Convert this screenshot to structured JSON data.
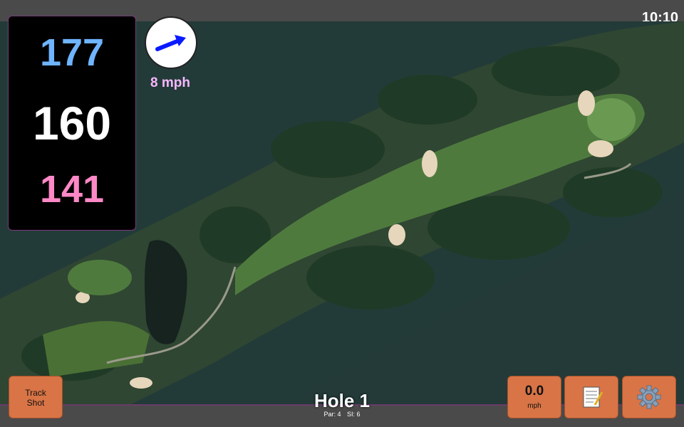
{
  "clock": "10:10",
  "distances": {
    "back": "177",
    "middle": "160",
    "front": "141"
  },
  "wind": {
    "speed": "8 mph",
    "icon": "wind-arrow-icon"
  },
  "buttons": {
    "track_line1": "Track",
    "track_line2": "Shot",
    "speed_value": "0.0",
    "speed_unit": "mph",
    "notes_icon": "notepad-icon",
    "settings_icon": "gear-icon"
  },
  "hole": {
    "title": "Hole 1",
    "par": "Par: 4",
    "si": "SI: 6"
  },
  "colors": {
    "back": "#6fb4ff",
    "middle": "#ffffff",
    "front": "#ff88c6",
    "button": "#d87446",
    "wind_text": "#f6b8ff"
  }
}
